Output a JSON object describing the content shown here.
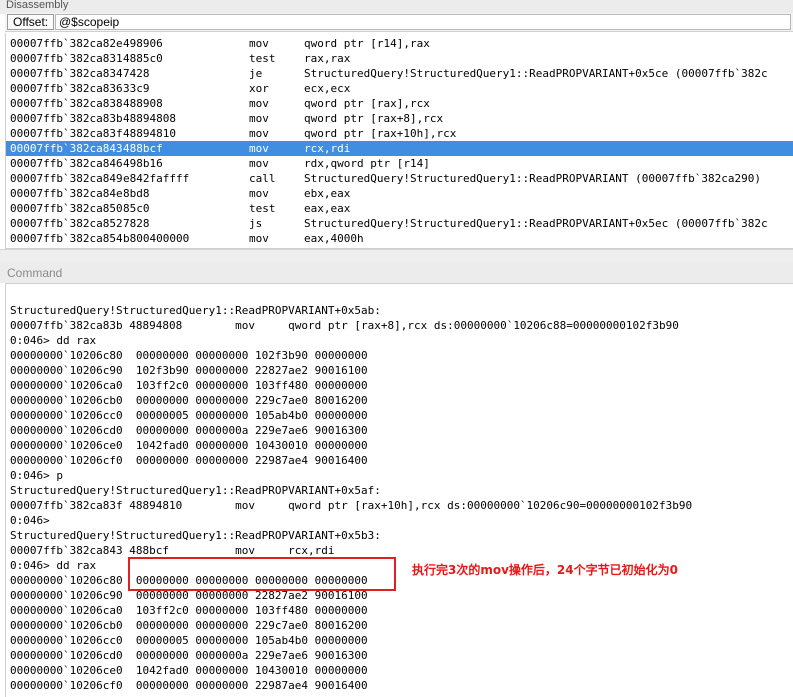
{
  "disassembly": {
    "title": "Disassembly",
    "offset_label": "Offset:",
    "offset_value": "@$scopeip",
    "rows": [
      {
        "addr": "00007ffb`382ca82e",
        "bytes": "498906",
        "op": "mov",
        "args": "qword ptr [r14],rax"
      },
      {
        "addr": "00007ffb`382ca831",
        "bytes": "4885c0",
        "op": "test",
        "args": "rax,rax"
      },
      {
        "addr": "00007ffb`382ca834",
        "bytes": "7428",
        "op": "je",
        "args": "StructuredQuery!StructuredQuery1::ReadPROPVARIANT+0x5ce (00007ffb`382c"
      },
      {
        "addr": "00007ffb`382ca836",
        "bytes": "33c9",
        "op": "xor",
        "args": "ecx,ecx"
      },
      {
        "addr": "00007ffb`382ca838",
        "bytes": "488908",
        "op": "mov",
        "args": "qword ptr [rax],rcx"
      },
      {
        "addr": "00007ffb`382ca83b",
        "bytes": "48894808",
        "op": "mov",
        "args": "qword ptr [rax+8],rcx"
      },
      {
        "addr": "00007ffb`382ca83f",
        "bytes": "48894810",
        "op": "mov",
        "args": "qword ptr [rax+10h],rcx"
      },
      {
        "addr": "00007ffb`382ca843",
        "bytes": "488bcf",
        "op": "mov",
        "args": "rcx,rdi",
        "selected": true
      },
      {
        "addr": "00007ffb`382ca846",
        "bytes": "498b16",
        "op": "mov",
        "args": "rdx,qword ptr [r14]"
      },
      {
        "addr": "00007ffb`382ca849",
        "bytes": "e842faffff",
        "op": "call",
        "args": "StructuredQuery!StructuredQuery1::ReadPROPVARIANT (00007ffb`382ca290)"
      },
      {
        "addr": "00007ffb`382ca84e",
        "bytes": "8bd8",
        "op": "mov",
        "args": "ebx,eax"
      },
      {
        "addr": "00007ffb`382ca850",
        "bytes": "85c0",
        "op": "test",
        "args": "eax,eax"
      },
      {
        "addr": "00007ffb`382ca852",
        "bytes": "7828",
        "op": "js",
        "args": "StructuredQuery!StructuredQuery1::ReadPROPVARIANT+0x5ec (00007ffb`382c"
      },
      {
        "addr": "00007ffb`382ca854",
        "bytes": "b800400000",
        "op": "mov",
        "args": "eax,4000h"
      }
    ]
  },
  "command": {
    "title": "Command",
    "lines": [
      "",
      "StructuredQuery!StructuredQuery1::ReadPROPVARIANT+0x5ab:",
      "00007ffb`382ca83b 48894808        mov     qword ptr [rax+8],rcx ds:00000000`10206c88=00000000102f3b90",
      "0:046> dd rax",
      "00000000`10206c80  00000000 00000000 102f3b90 00000000",
      "00000000`10206c90  102f3b90 00000000 22827ae2 90016100",
      "00000000`10206ca0  103ff2c0 00000000 103ff480 00000000",
      "00000000`10206cb0  00000000 00000000 229c7ae0 80016200",
      "00000000`10206cc0  00000005 00000000 105ab4b0 00000000",
      "00000000`10206cd0  00000000 0000000a 229e7ae6 90016300",
      "00000000`10206ce0  1042fad0 00000000 10430010 00000000",
      "00000000`10206cf0  00000000 00000000 22987ae4 90016400",
      "0:046> p",
      "StructuredQuery!StructuredQuery1::ReadPROPVARIANT+0x5af:",
      "00007ffb`382ca83f 48894810        mov     qword ptr [rax+10h],rcx ds:00000000`10206c90=00000000102f3b90",
      "0:046>",
      "StructuredQuery!StructuredQuery1::ReadPROPVARIANT+0x5b3:",
      "00007ffb`382ca843 488bcf          mov     rcx,rdi",
      "0:046> dd rax",
      "00000000`10206c80  00000000 00000000 00000000 00000000",
      "00000000`10206c90  00000000 00000000 22827ae2 90016100",
      "00000000`10206ca0  103ff2c0 00000000 103ff480 00000000",
      "00000000`10206cb0  00000000 00000000 229c7ae0 80016200",
      "00000000`10206cc0  00000005 00000000 105ab4b0 00000000",
      "00000000`10206cd0  00000000 0000000a 229e7ae6 90016300",
      "00000000`10206ce0  1042fad0 00000000 10430010 00000000",
      "00000000`10206cf0  00000000 00000000 22987ae4 90016400"
    ]
  },
  "annotation": {
    "text": "执行完3次的mov操作后，24个字节已初始化为0",
    "color": "#e81818"
  },
  "colors": {
    "selection": "#3f8edf",
    "highlight_border": "#e02020"
  }
}
